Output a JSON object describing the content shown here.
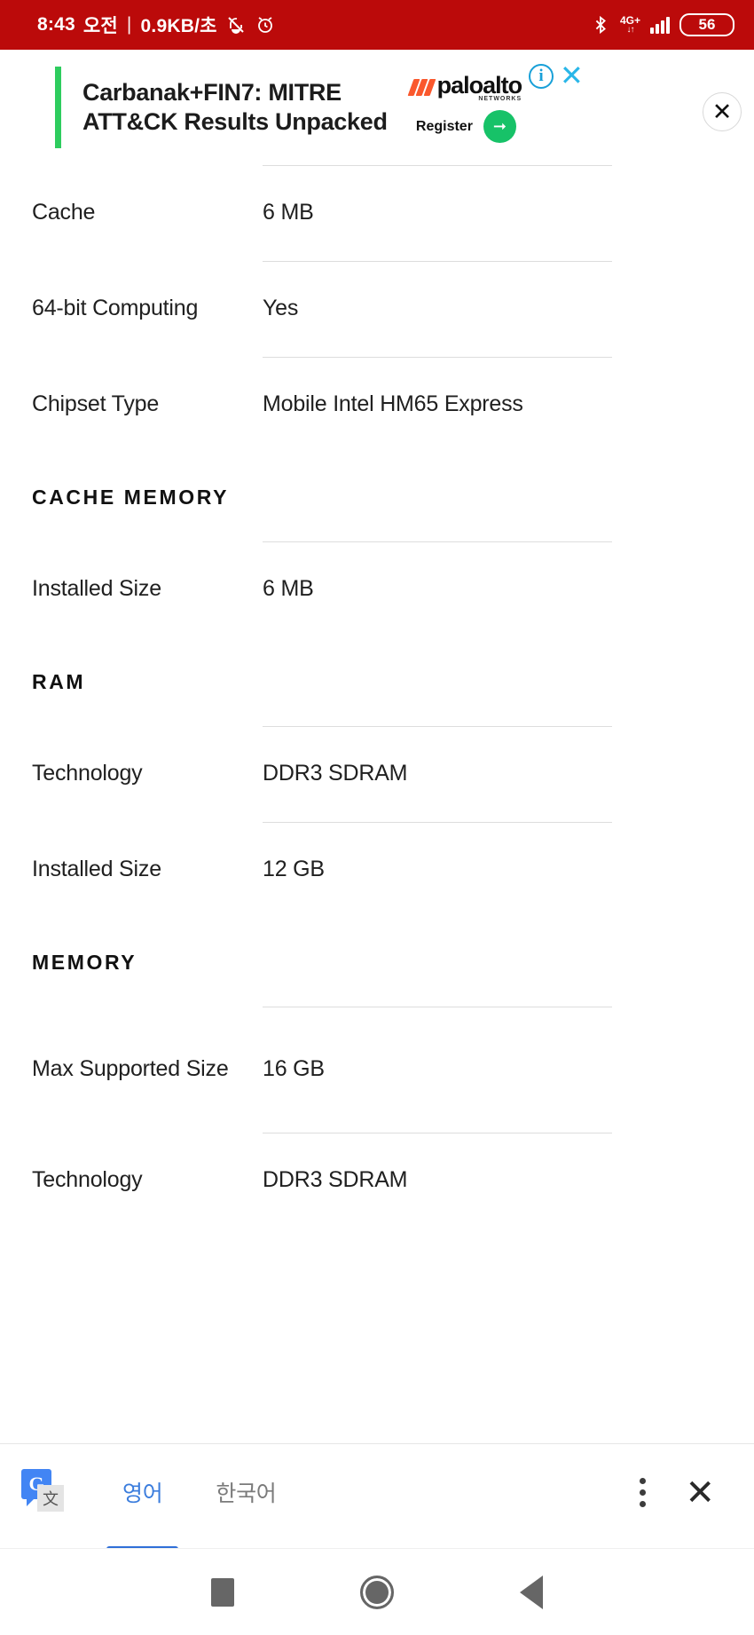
{
  "status_bar": {
    "time": "8:43",
    "meridiem": "오전",
    "separator": "|",
    "data_rate": "0.9KB/초",
    "mute_icon": "bell-mute-icon",
    "alarm_icon": "alarm-clock-icon",
    "bluetooth_icon": "bluetooth-icon",
    "network_label": "4G+",
    "network_sub": "↓↑",
    "signal_icon": "signal-bars-icon",
    "battery_level": "56",
    "background_color": "#bb0a0a"
  },
  "ad": {
    "headline": "Carbanak+FIN7: MITRE\nATT&CK Results Unpacked",
    "brand_name": "paloalto",
    "brand_sub": "NETWORKS",
    "cta_label": "Register",
    "cta_arrow": "arrow-right-icon",
    "adchoices_icon": "info-circle-icon",
    "dismiss_icon": "close-icon",
    "close_icon": "close-circle-icon",
    "accent_bar_color": "#2ecc5e",
    "brand_mark_color": "#fa582d",
    "cta_color": "#17c268"
  },
  "specs": [
    {
      "type": "kv",
      "label": "Cache",
      "value": "6 MB"
    },
    {
      "type": "kv",
      "label": "64-bit Computing",
      "value": "Yes"
    },
    {
      "type": "kv",
      "label": "Chipset Type",
      "value": "Mobile Intel HM65 Express"
    },
    {
      "type": "section",
      "label": "CACHE MEMORY"
    },
    {
      "type": "kv",
      "label": "Installed Size",
      "value": "6 MB"
    },
    {
      "type": "section",
      "label": "RAM"
    },
    {
      "type": "kv",
      "label": "Technology",
      "value": "DDR3 SDRAM"
    },
    {
      "type": "kv",
      "label": "Installed Size",
      "value": "12 GB"
    },
    {
      "type": "section",
      "label": "MEMORY"
    },
    {
      "type": "kv_tall",
      "label": "Max Supported Size",
      "value": "16 GB"
    },
    {
      "type": "kv",
      "label": "Technology",
      "value": "DDR3 SDRAM"
    }
  ],
  "translate_bar": {
    "logo_icon": "google-translate-icon",
    "logo_letter": "G",
    "logo_glyph": "文",
    "tabs": [
      {
        "label": "영어",
        "active": true
      },
      {
        "label": "한국어",
        "active": false
      }
    ],
    "overflow_icon": "more-vertical-icon",
    "close_icon": "close-icon",
    "active_color": "#3b7ddd",
    "inactive_color": "#7b7b7b"
  },
  "nav_bar": {
    "recents_icon": "square-recents-icon",
    "home_icon": "circle-home-icon",
    "back_icon": "triangle-back-icon"
  }
}
